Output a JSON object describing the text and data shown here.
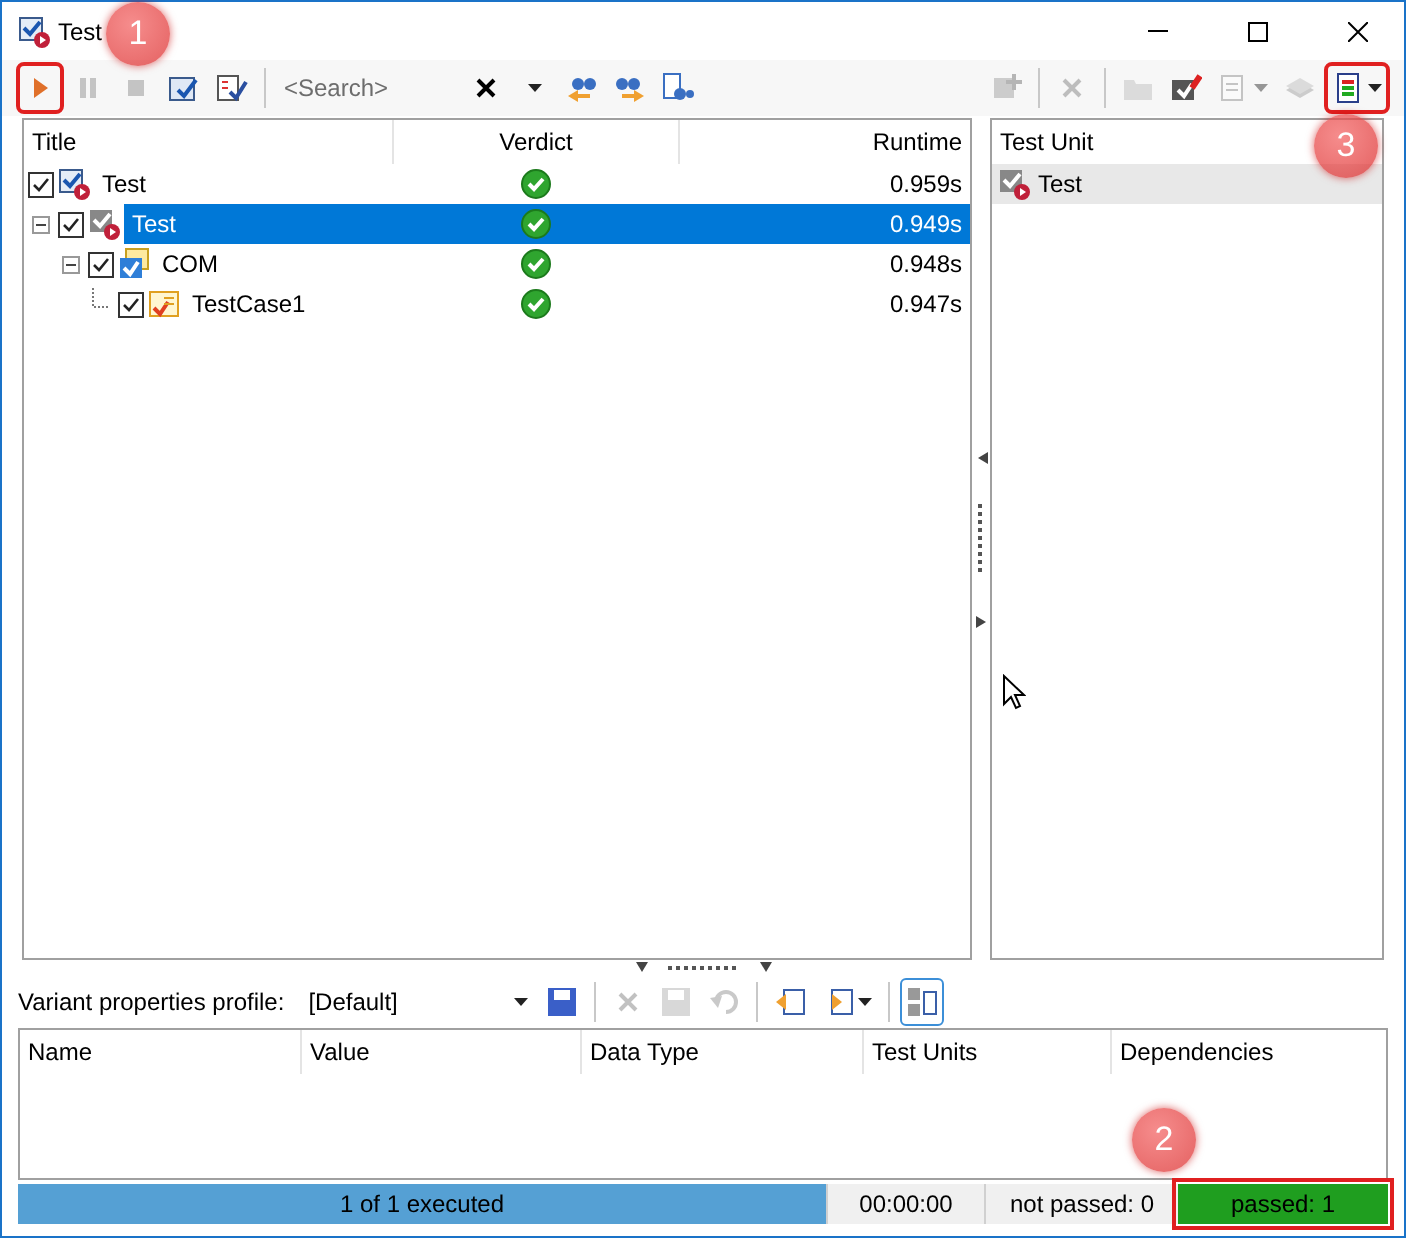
{
  "window": {
    "title": "Test"
  },
  "toolbar": {
    "left": [
      {
        "kind": "button",
        "disabled": false,
        "callout": "1"
      },
      {
        "kind": "button",
        "disabled": true
      },
      {
        "kind": "button",
        "disabled": true
      },
      {
        "kind": "button",
        "disabled": false
      },
      {
        "kind": "button",
        "disabled": false
      },
      {
        "kind": "separator"
      },
      {
        "kind": "search",
        "placeholder": "<Search>"
      },
      {
        "kind": "button",
        "disabled": false
      },
      {
        "kind": "dropdown",
        "disabled": false
      },
      {
        "kind": "button",
        "disabled": false
      },
      {
        "kind": "button",
        "disabled": false
      },
      {
        "kind": "button",
        "disabled": false
      }
    ],
    "right": [
      {
        "kind": "button",
        "disabled": true
      },
      {
        "kind": "separator"
      },
      {
        "kind": "button",
        "disabled": true
      },
      {
        "kind": "separator"
      },
      {
        "kind": "button",
        "disabled": true
      },
      {
        "kind": "button",
        "disabled": false
      },
      {
        "kind": "split",
        "disabled": true
      },
      {
        "kind": "button",
        "disabled": true
      },
      {
        "kind": "split",
        "disabled": false,
        "callout": "3"
      }
    ]
  },
  "tree": {
    "columns": [
      "Title",
      "Verdict",
      "Runtime"
    ],
    "rows": [
      {
        "kind": "configuration",
        "title": "Test",
        "checked": true,
        "passed": true,
        "runtime": "0.959s",
        "selected": false,
        "children": [
          {
            "kind": "unit",
            "title": "Test",
            "checked": true,
            "passed": true,
            "runtime": "0.949s",
            "selected": true,
            "expanded": true,
            "children": [
              {
                "kind": "group",
                "title": "COM",
                "checked": true,
                "passed": true,
                "runtime": "0.948s",
                "selected": false,
                "expanded": true,
                "children": [
                  {
                    "kind": "case",
                    "title": "TestCase1",
                    "checked": true,
                    "passed": true,
                    "runtime": "0.947s",
                    "selected": false
                  }
                ]
              }
            ]
          }
        ]
      }
    ]
  },
  "test_units": {
    "column": "Test Unit",
    "items": [
      {
        "title": "Test",
        "selected": true
      }
    ]
  },
  "variant": {
    "label": "Variant properties profile:",
    "profile": "[Default]",
    "buttons": [
      {
        "kind": "button",
        "disabled": false
      },
      {
        "kind": "separator"
      },
      {
        "kind": "button",
        "disabled": true
      },
      {
        "kind": "button",
        "disabled": true
      },
      {
        "kind": "button",
        "disabled": true
      },
      {
        "kind": "separator"
      },
      {
        "kind": "button",
        "disabled": false
      },
      {
        "kind": "split",
        "disabled": false
      },
      {
        "kind": "separator"
      },
      {
        "kind": "toggle",
        "disabled": false,
        "pressed": true
      }
    ],
    "columns": [
      "Name",
      "Value",
      "Data Type",
      "Test Units",
      "Dependencies"
    ]
  },
  "status_bar": {
    "progress": {
      "level": 1,
      "label": "1 of 1 executed"
    },
    "time": "00:00:00",
    "not_passed": "not passed: 0",
    "passed": {
      "label": "passed: 1",
      "callout": "2"
    }
  }
}
